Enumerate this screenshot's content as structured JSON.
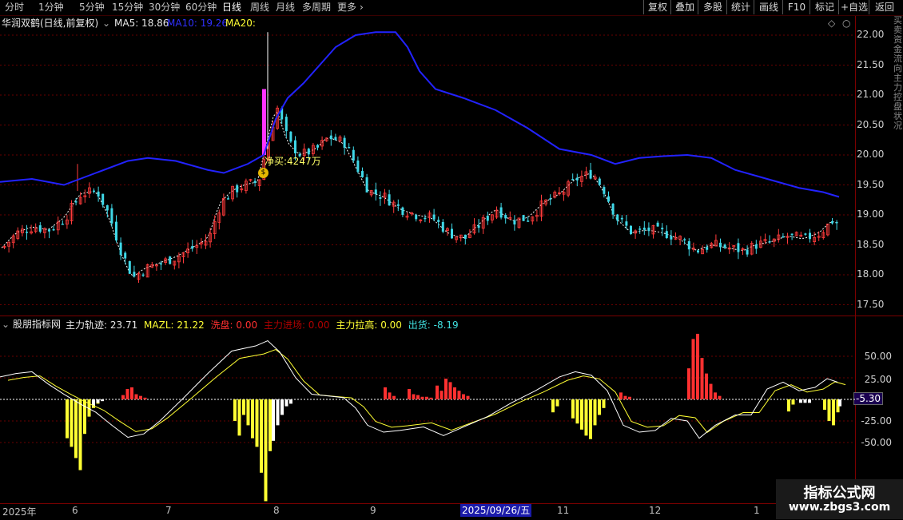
{
  "toolbar": {
    "periods": [
      "分时",
      "1分钟",
      "5分钟",
      "15分钟",
      "30分钟",
      "60分钟",
      "日线",
      "周线",
      "月线",
      "多周期",
      "更多"
    ],
    "active_period": "日线",
    "right_buttons": [
      "复权",
      "叠加",
      "多股",
      "统计",
      "画线",
      "F10",
      "标记",
      "+自选",
      "返回"
    ]
  },
  "main_chart": {
    "title": "华润双鹤(日线,前复权)",
    "ma5_label": "MA5: 18.86",
    "ma10_label": "MA10: 19.26",
    "ma20_label": "MA20:",
    "annotation": "净买:4247万",
    "annotation_icon": "money-bag-icon",
    "price_ticks": [
      "22.00",
      "21.50",
      "21.00",
      "20.50",
      "20.00",
      "19.50",
      "19.00",
      "18.50",
      "18.00",
      "17.50"
    ],
    "colors": {
      "up": "#ff3b3b",
      "down": "#3fd8e8",
      "ma": "#2020ff",
      "highlight": "#ff33ff",
      "title": "#e8e8e8"
    }
  },
  "indicator": {
    "title": "股朋指标网",
    "items": [
      {
        "label": "主力轨迹: 23.71",
        "color": "#e8e8e8"
      },
      {
        "label": "MAZL: 21.22",
        "color": "#ffff33"
      },
      {
        "label": "洗盘: 0.00",
        "color": "#ff3030"
      },
      {
        "label": "主力进场: 0.00",
        "color": "#b00000"
      },
      {
        "label": "主力拉高: 0.00",
        "color": "#ffff33"
      },
      {
        "label": "出货: -8.19",
        "color": "#40e0e0"
      }
    ],
    "ticks": [
      "50.00",
      "25.00",
      "-25.00",
      "-50.00"
    ],
    "current_value": "-5.30"
  },
  "date_axis": {
    "labels": [
      "2025年",
      "6",
      "7",
      "8",
      "9",
      "11",
      "12",
      "1"
    ],
    "cursor_date": "2025/09/26/五"
  },
  "watermark": {
    "line1": "指标公式网",
    "line2": "www.zbgs3.com"
  },
  "side_strip_text": "买卖资金流向主力控盘状况"
}
